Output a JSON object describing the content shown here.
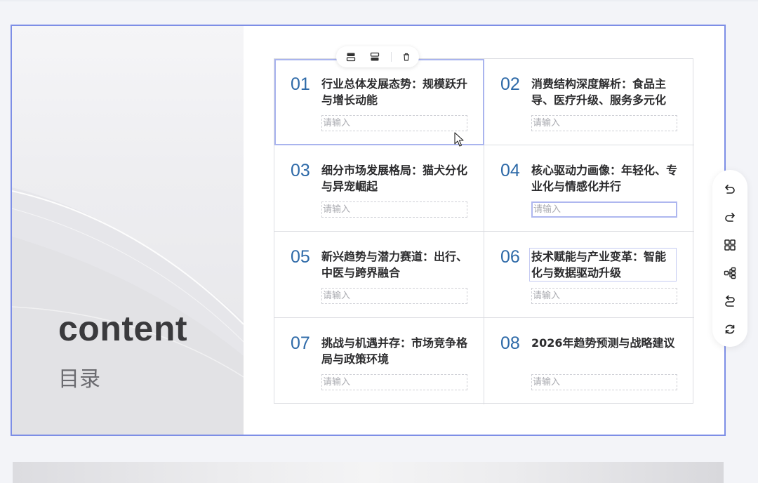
{
  "slide": {
    "title": "content",
    "subtitle": "目录"
  },
  "placeholder": "请输入",
  "items": [
    {
      "num": "01",
      "title": "行业总体发展态势：规模跃升与增长动能"
    },
    {
      "num": "02",
      "title": "消费结构深度解析：食品主导、医疗升级、服务多元化"
    },
    {
      "num": "03",
      "title": "细分市场发展格局：猫犬分化与异宠崛起"
    },
    {
      "num": "04",
      "title": "核心驱动力画像：年轻化、专业化与情感化并行"
    },
    {
      "num": "05",
      "title": "新兴趋势与潜力赛道：出行、中医与跨界融合"
    },
    {
      "num": "06",
      "title": "技术赋能与产业变革：智能化与数据驱动升级"
    },
    {
      "num": "07",
      "title": "挑战与机遇并存：市场竞争格局与政策环境"
    },
    {
      "num": "08",
      "title": "2026年趋势预测与战略建议"
    }
  ],
  "colors": {
    "accent": "#2e6aa8",
    "selection": "#7d8ee6"
  },
  "icons": {
    "cell_toolbar": [
      "insert-row-above-icon",
      "insert-row-below-icon",
      "delete-icon"
    ],
    "side_toolbar": [
      "undo-icon",
      "redo-icon",
      "layout-grid-icon",
      "structure-icon",
      "convert-icon",
      "refresh-icon"
    ]
  }
}
